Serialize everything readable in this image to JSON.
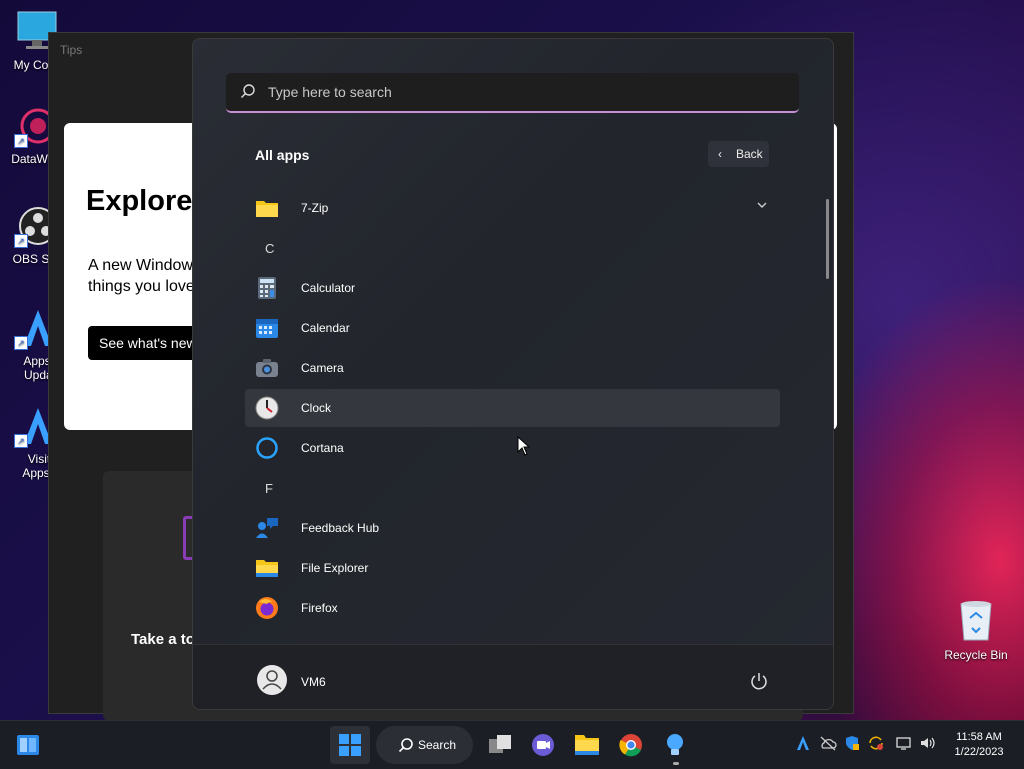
{
  "desktop": {
    "icons": [
      {
        "label": "My Com"
      },
      {
        "label": "DataWag"
      },
      {
        "label": "OBS Stu"
      },
      {
        "label": "Appsit Updat"
      },
      {
        "label": "Visit Appsit"
      }
    ],
    "recycle_bin": "Recycle Bin"
  },
  "tips_window": {
    "title": "Tips",
    "card_heading": "Explore",
    "card_desc": "A new Window things you love",
    "card_button": "See what's new",
    "card2_text": "Take a to"
  },
  "start_menu": {
    "search_placeholder": "Type here to search",
    "all_apps_label": "All apps",
    "back_label": "Back",
    "letters": {
      "c": "C",
      "f": "F"
    },
    "apps": {
      "zip": "7-Zip",
      "calculator": "Calculator",
      "calendar": "Calendar",
      "camera": "Camera",
      "clock": "Clock",
      "cortana": "Cortana",
      "feedback": "Feedback Hub",
      "explorer": "File Explorer",
      "firefox": "Firefox"
    },
    "user_name": "VM6"
  },
  "taskbar": {
    "search_label": "Search",
    "time": "11:58 AM",
    "date": "1/22/2023"
  },
  "colors": {
    "accent": "#c690d6",
    "start_bg": "#2a2d35",
    "taskbar_bg": "#1c1e26"
  }
}
